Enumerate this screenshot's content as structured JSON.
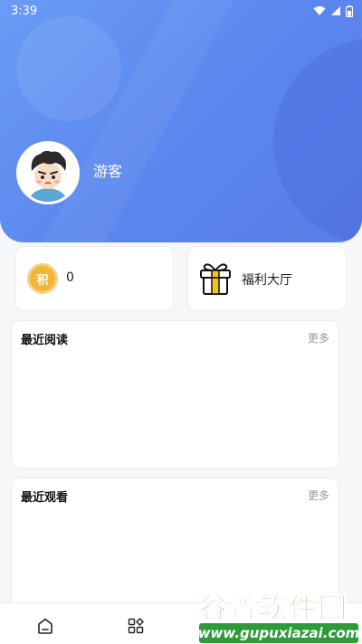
{
  "status_bar": {
    "time": "3:39"
  },
  "profile": {
    "username": "游客"
  },
  "points": {
    "badge": "积",
    "value": "0"
  },
  "welfare": {
    "label": "福利大厅"
  },
  "sections": {
    "recent_read": {
      "title": "最近阅读",
      "more": "更多"
    },
    "recent_watch": {
      "title": "最近观看",
      "more": "更多"
    }
  },
  "bottom_nav": [
    {
      "icon": "home-icon"
    },
    {
      "icon": "category-grid-icon"
    }
  ],
  "watermark": {
    "title": "谷普软件园",
    "url": "www.gupuxiazai.com"
  },
  "colors": {
    "header_start": "#6a9cf5",
    "header_end": "#5a7de6",
    "coin": "#f1b53a",
    "watermark_green": "#2f9a3a"
  }
}
